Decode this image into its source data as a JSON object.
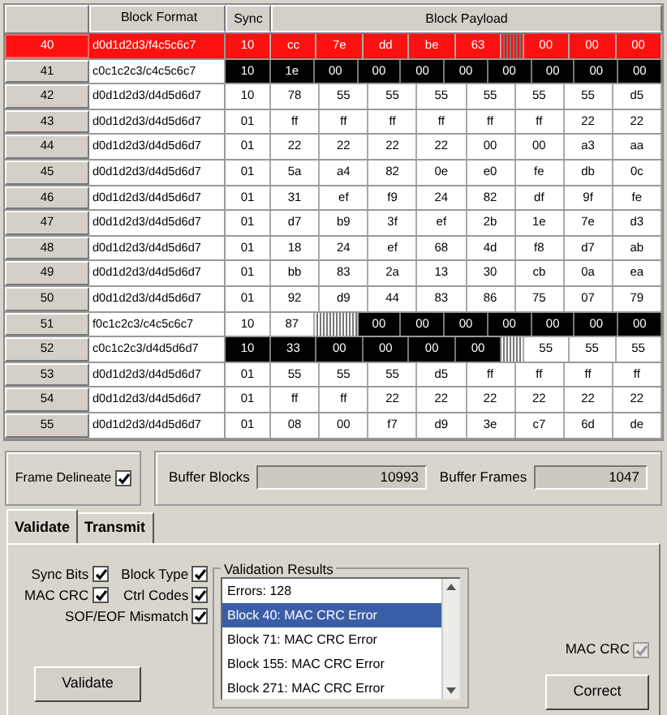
{
  "table": {
    "columns": [
      "",
      "Block Format",
      "Sync",
      "Block Payload"
    ],
    "rows": [
      {
        "number": "40",
        "format": "d0d1d2d3/f4c5c6c7",
        "sync": {
          "text": "10",
          "kind": "data"
        },
        "payload": [
          {
            "text": "cc",
            "kind": "data"
          },
          {
            "text": "7e",
            "kind": "data"
          },
          {
            "text": "dd",
            "kind": "data"
          },
          {
            "text": "be",
            "kind": "data"
          },
          {
            "text": "63",
            "kind": "data"
          },
          {
            "kind": "hatch"
          },
          {
            "text": "00",
            "kind": "data"
          },
          {
            "text": "00",
            "kind": "data"
          },
          {
            "text": "00",
            "kind": "data"
          }
        ],
        "selected": true
      },
      {
        "number": "41",
        "format": "c0c1c2c3/c4c5c6c7",
        "sync": {
          "text": "10",
          "kind": "ctrl"
        },
        "payload": [
          {
            "text": "1e",
            "kind": "ctrl"
          },
          {
            "text": "00",
            "kind": "ctrl"
          },
          {
            "text": "00",
            "kind": "ctrl"
          },
          {
            "text": "00",
            "kind": "ctrl"
          },
          {
            "text": "00",
            "kind": "ctrl"
          },
          {
            "text": "00",
            "kind": "ctrl"
          },
          {
            "text": "00",
            "kind": "ctrl"
          },
          {
            "text": "00",
            "kind": "ctrl"
          },
          {
            "text": "00",
            "kind": "ctrl"
          }
        ],
        "selected": false
      },
      {
        "number": "42",
        "format": "d0d1d2d3/d4d5d6d7",
        "sync": {
          "text": "10",
          "kind": "data"
        },
        "payload": [
          {
            "text": "78",
            "kind": "data"
          },
          {
            "text": "55",
            "kind": "data"
          },
          {
            "text": "55",
            "kind": "data"
          },
          {
            "text": "55",
            "kind": "data"
          },
          {
            "text": "55",
            "kind": "data"
          },
          {
            "text": "55",
            "kind": "data"
          },
          {
            "text": "55",
            "kind": "data"
          },
          {
            "text": "d5",
            "kind": "data"
          }
        ],
        "selected": false
      },
      {
        "number": "43",
        "format": "d0d1d2d3/d4d5d6d7",
        "sync": {
          "text": "01",
          "kind": "data"
        },
        "payload": [
          {
            "text": "ff",
            "kind": "data"
          },
          {
            "text": "ff",
            "kind": "data"
          },
          {
            "text": "ff",
            "kind": "data"
          },
          {
            "text": "ff",
            "kind": "data"
          },
          {
            "text": "ff",
            "kind": "data"
          },
          {
            "text": "ff",
            "kind": "data"
          },
          {
            "text": "22",
            "kind": "data"
          },
          {
            "text": "22",
            "kind": "data"
          }
        ],
        "selected": false
      },
      {
        "number": "44",
        "format": "d0d1d2d3/d4d5d6d7",
        "sync": {
          "text": "01",
          "kind": "data"
        },
        "payload": [
          {
            "text": "22",
            "kind": "data"
          },
          {
            "text": "22",
            "kind": "data"
          },
          {
            "text": "22",
            "kind": "data"
          },
          {
            "text": "22",
            "kind": "data"
          },
          {
            "text": "00",
            "kind": "data"
          },
          {
            "text": "00",
            "kind": "data"
          },
          {
            "text": "a3",
            "kind": "data"
          },
          {
            "text": "aa",
            "kind": "data"
          }
        ],
        "selected": false
      },
      {
        "number": "45",
        "format": "d0d1d2d3/d4d5d6d7",
        "sync": {
          "text": "01",
          "kind": "data"
        },
        "payload": [
          {
            "text": "5a",
            "kind": "data"
          },
          {
            "text": "a4",
            "kind": "data"
          },
          {
            "text": "82",
            "kind": "data"
          },
          {
            "text": "0e",
            "kind": "data"
          },
          {
            "text": "e0",
            "kind": "data"
          },
          {
            "text": "fe",
            "kind": "data"
          },
          {
            "text": "db",
            "kind": "data"
          },
          {
            "text": "0c",
            "kind": "data"
          }
        ],
        "selected": false
      },
      {
        "number": "46",
        "format": "d0d1d2d3/d4d5d6d7",
        "sync": {
          "text": "01",
          "kind": "data"
        },
        "payload": [
          {
            "text": "31",
            "kind": "data"
          },
          {
            "text": "ef",
            "kind": "data"
          },
          {
            "text": "f9",
            "kind": "data"
          },
          {
            "text": "24",
            "kind": "data"
          },
          {
            "text": "82",
            "kind": "data"
          },
          {
            "text": "df",
            "kind": "data"
          },
          {
            "text": "9f",
            "kind": "data"
          },
          {
            "text": "fe",
            "kind": "data"
          }
        ],
        "selected": false
      },
      {
        "number": "47",
        "format": "d0d1d2d3/d4d5d6d7",
        "sync": {
          "text": "01",
          "kind": "data"
        },
        "payload": [
          {
            "text": "d7",
            "kind": "data"
          },
          {
            "text": "b9",
            "kind": "data"
          },
          {
            "text": "3f",
            "kind": "data"
          },
          {
            "text": "ef",
            "kind": "data"
          },
          {
            "text": "2b",
            "kind": "data"
          },
          {
            "text": "1e",
            "kind": "data"
          },
          {
            "text": "7e",
            "kind": "data"
          },
          {
            "text": "d3",
            "kind": "data"
          }
        ],
        "selected": false
      },
      {
        "number": "48",
        "format": "d0d1d2d3/d4d5d6d7",
        "sync": {
          "text": "01",
          "kind": "data"
        },
        "payload": [
          {
            "text": "18",
            "kind": "data"
          },
          {
            "text": "24",
            "kind": "data"
          },
          {
            "text": "ef",
            "kind": "data"
          },
          {
            "text": "68",
            "kind": "data"
          },
          {
            "text": "4d",
            "kind": "data"
          },
          {
            "text": "f8",
            "kind": "data"
          },
          {
            "text": "d7",
            "kind": "data"
          },
          {
            "text": "ab",
            "kind": "data"
          }
        ],
        "selected": false
      },
      {
        "number": "49",
        "format": "d0d1d2d3/d4d5d6d7",
        "sync": {
          "text": "01",
          "kind": "data"
        },
        "payload": [
          {
            "text": "bb",
            "kind": "data"
          },
          {
            "text": "83",
            "kind": "data"
          },
          {
            "text": "2a",
            "kind": "data"
          },
          {
            "text": "13",
            "kind": "data"
          },
          {
            "text": "30",
            "kind": "data"
          },
          {
            "text": "cb",
            "kind": "data"
          },
          {
            "text": "0a",
            "kind": "data"
          },
          {
            "text": "ea",
            "kind": "data"
          }
        ],
        "selected": false
      },
      {
        "number": "50",
        "format": "d0d1d2d3/d4d5d6d7",
        "sync": {
          "text": "01",
          "kind": "data"
        },
        "payload": [
          {
            "text": "92",
            "kind": "data"
          },
          {
            "text": "d9",
            "kind": "data"
          },
          {
            "text": "44",
            "kind": "data"
          },
          {
            "text": "83",
            "kind": "data"
          },
          {
            "text": "86",
            "kind": "data"
          },
          {
            "text": "75",
            "kind": "data"
          },
          {
            "text": "07",
            "kind": "data"
          },
          {
            "text": "79",
            "kind": "data"
          }
        ],
        "selected": false
      },
      {
        "number": "51",
        "format": "f0c1c2c3/c4c5c6c7",
        "sync": {
          "text": "10",
          "kind": "data"
        },
        "payload": [
          {
            "text": "87",
            "kind": "data"
          },
          {
            "kind": "hatch"
          },
          {
            "text": "00",
            "kind": "ctrl"
          },
          {
            "text": "00",
            "kind": "ctrl"
          },
          {
            "text": "00",
            "kind": "ctrl"
          },
          {
            "text": "00",
            "kind": "ctrl"
          },
          {
            "text": "00",
            "kind": "ctrl"
          },
          {
            "text": "00",
            "kind": "ctrl"
          },
          {
            "text": "00",
            "kind": "ctrl"
          }
        ],
        "selected": false
      },
      {
        "number": "52",
        "format": "c0c1c2c3/d4d5d6d7",
        "sync": {
          "text": "10",
          "kind": "ctrl"
        },
        "payload": [
          {
            "text": "33",
            "kind": "ctrl"
          },
          {
            "text": "00",
            "kind": "ctrl"
          },
          {
            "text": "00",
            "kind": "ctrl"
          },
          {
            "text": "00",
            "kind": "ctrl"
          },
          {
            "text": "00",
            "kind": "ctrl"
          },
          {
            "kind": "hatch"
          },
          {
            "text": "55",
            "kind": "data"
          },
          {
            "text": "55",
            "kind": "data"
          },
          {
            "text": "55",
            "kind": "data"
          }
        ],
        "selected": false
      },
      {
        "number": "53",
        "format": "d0d1d2d3/d4d5d6d7",
        "sync": {
          "text": "01",
          "kind": "data"
        },
        "payload": [
          {
            "text": "55",
            "kind": "data"
          },
          {
            "text": "55",
            "kind": "data"
          },
          {
            "text": "55",
            "kind": "data"
          },
          {
            "text": "d5",
            "kind": "data"
          },
          {
            "text": "ff",
            "kind": "data"
          },
          {
            "text": "ff",
            "kind": "data"
          },
          {
            "text": "ff",
            "kind": "data"
          },
          {
            "text": "ff",
            "kind": "data"
          }
        ],
        "selected": false
      },
      {
        "number": "54",
        "format": "d0d1d2d3/d4d5d6d7",
        "sync": {
          "text": "01",
          "kind": "data"
        },
        "payload": [
          {
            "text": "ff",
            "kind": "data"
          },
          {
            "text": "ff",
            "kind": "data"
          },
          {
            "text": "22",
            "kind": "data"
          },
          {
            "text": "22",
            "kind": "data"
          },
          {
            "text": "22",
            "kind": "data"
          },
          {
            "text": "22",
            "kind": "data"
          },
          {
            "text": "22",
            "kind": "data"
          },
          {
            "text": "22",
            "kind": "data"
          }
        ],
        "selected": false
      },
      {
        "number": "55",
        "format": "d0d1d2d3/d4d5d6d7",
        "sync": {
          "text": "01",
          "kind": "data"
        },
        "payload": [
          {
            "text": "08",
            "kind": "data"
          },
          {
            "text": "00",
            "kind": "data"
          },
          {
            "text": "f7",
            "kind": "data"
          },
          {
            "text": "d9",
            "kind": "data"
          },
          {
            "text": "3e",
            "kind": "data"
          },
          {
            "text": "c7",
            "kind": "data"
          },
          {
            "text": "6d",
            "kind": "data"
          },
          {
            "text": "de",
            "kind": "data"
          }
        ],
        "selected": false
      }
    ]
  },
  "frame_delineate": {
    "label": "Frame Delineate",
    "checked": true
  },
  "buffer_blocks": {
    "label": "Buffer Blocks",
    "value": "10993"
  },
  "buffer_frames": {
    "label": "Buffer Frames",
    "value": "1047"
  },
  "tabs": [
    {
      "label": "Validate",
      "selected": true
    },
    {
      "label": "Transmit",
      "selected": false
    }
  ],
  "options": [
    {
      "label": "Sync Bits",
      "checked": true
    },
    {
      "label": "Block Type",
      "checked": true
    },
    {
      "label": "MAC CRC",
      "checked": true
    },
    {
      "label": "Ctrl Codes",
      "checked": true
    },
    {
      "label": "SOF/EOF Mismatch",
      "checked": true
    }
  ],
  "validation_results": {
    "title": "Validation Results",
    "items": [
      {
        "text": "Errors: 128",
        "selected": false
      },
      {
        "text": "Block 40: MAC CRC Error",
        "selected": true
      },
      {
        "text": "Block 71: MAC CRC Error",
        "selected": false
      },
      {
        "text": "Block 155: MAC CRC Error",
        "selected": false
      },
      {
        "text": "Block 271: MAC CRC Error",
        "selected": false
      }
    ]
  },
  "mac_crc": {
    "label": "MAC CRC",
    "checked": true,
    "disabled": true
  },
  "buttons": {
    "validate": "Validate",
    "correct": "Correct"
  }
}
